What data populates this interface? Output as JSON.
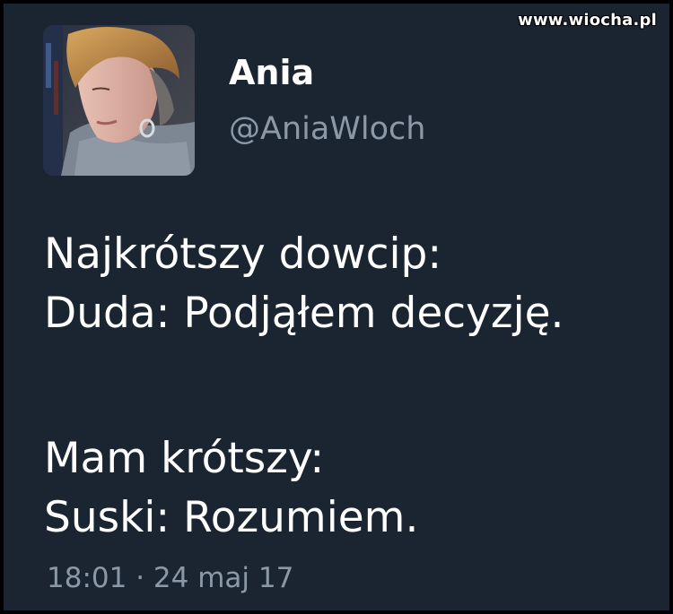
{
  "watermark": "www.wiocha.pl",
  "author": {
    "display_name": "Ania",
    "handle": "@AniaWloch",
    "avatar_icon": "profile-photo"
  },
  "tweet": {
    "lines": [
      "Najkrótszy dowcip:",
      "Duda: Podjąłem decyzję.",
      "Mam krótszy:",
      "Suski: Rozumiem."
    ]
  },
  "meta": {
    "timestamp": "18:01 · 24 maj 17"
  },
  "colors": {
    "background": "#1b2532",
    "text_primary": "#ffffff",
    "text_secondary": "#8b99a6"
  }
}
